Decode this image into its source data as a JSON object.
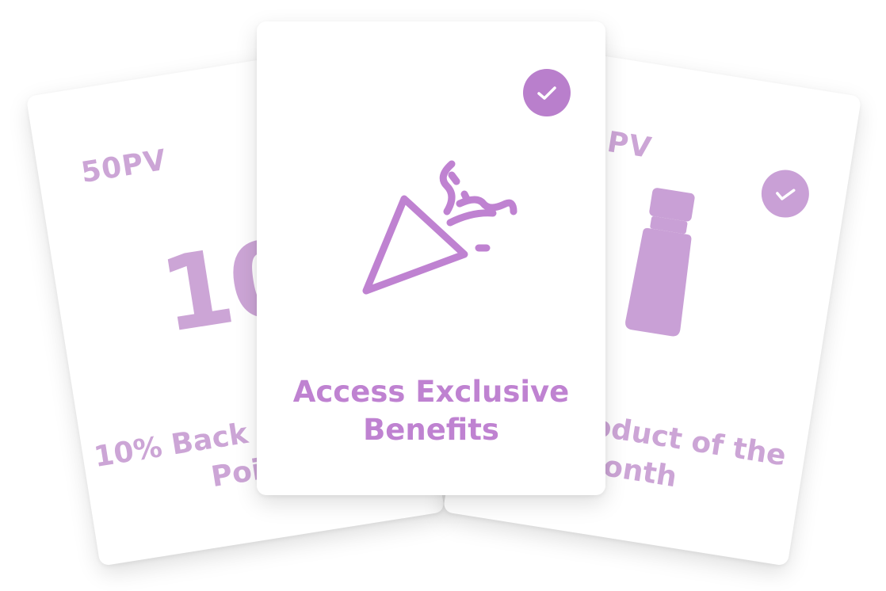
{
  "cards": {
    "left": {
      "pv": "50PV",
      "big_value": "10%",
      "title_line1": "10% Back in Reward",
      "title_line2": "Points"
    },
    "center": {
      "icon": "party-popper-icon",
      "title_line1": "Access Exclusive",
      "title_line2": "Benefits"
    },
    "right": {
      "pv": "125PV",
      "icon": "oil-bottle-icon",
      "title_line1": "Free Product of the",
      "title_line2": "Month"
    }
  },
  "colors": {
    "accent": "#bf82d1",
    "accent_faded": "#cca5d6",
    "card_bg": "#ffffff"
  }
}
